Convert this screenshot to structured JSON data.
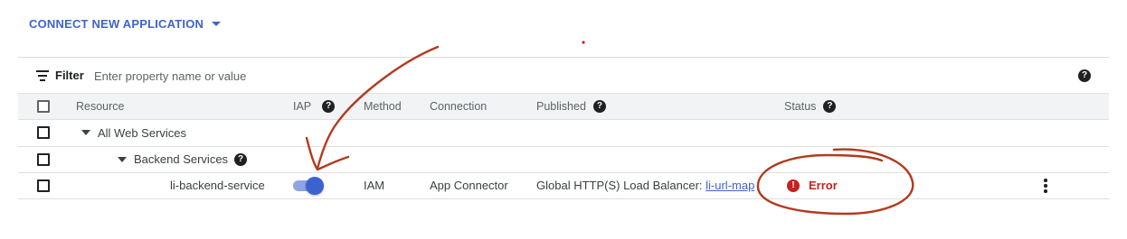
{
  "toolbar": {
    "connect_label": "CONNECT NEW APPLICATION",
    "connect_icon": "caret-down-icon"
  },
  "filter": {
    "label": "Filter",
    "placeholder": "Enter property name or value",
    "icon": "filter-icon",
    "help_icon": "help-icon"
  },
  "table": {
    "columns": {
      "resource": "Resource",
      "iap": "IAP",
      "method": "Method",
      "connection": "Connection",
      "published": "Published",
      "status": "Status"
    },
    "rows": [
      {
        "resource": "All Web Services"
      },
      {
        "resource": "Backend Services"
      },
      {
        "resource": "li-backend-service",
        "iap_enabled": true,
        "method": "IAM",
        "connection": "App Connector",
        "published_prefix": "Global HTTP(S) Load Balancer: ",
        "published_link": "li-url-map",
        "status": "Error"
      }
    ]
  },
  "colors": {
    "accent": "#3f64c9",
    "error": "#c5221f",
    "annotation": "#b23a1f",
    "toggle_on": "#3b63d0"
  },
  "annotations": {
    "arrow": "hand-drawn-arrow-to-iap-toggle",
    "circle": "hand-drawn-circle-around-error-status"
  }
}
